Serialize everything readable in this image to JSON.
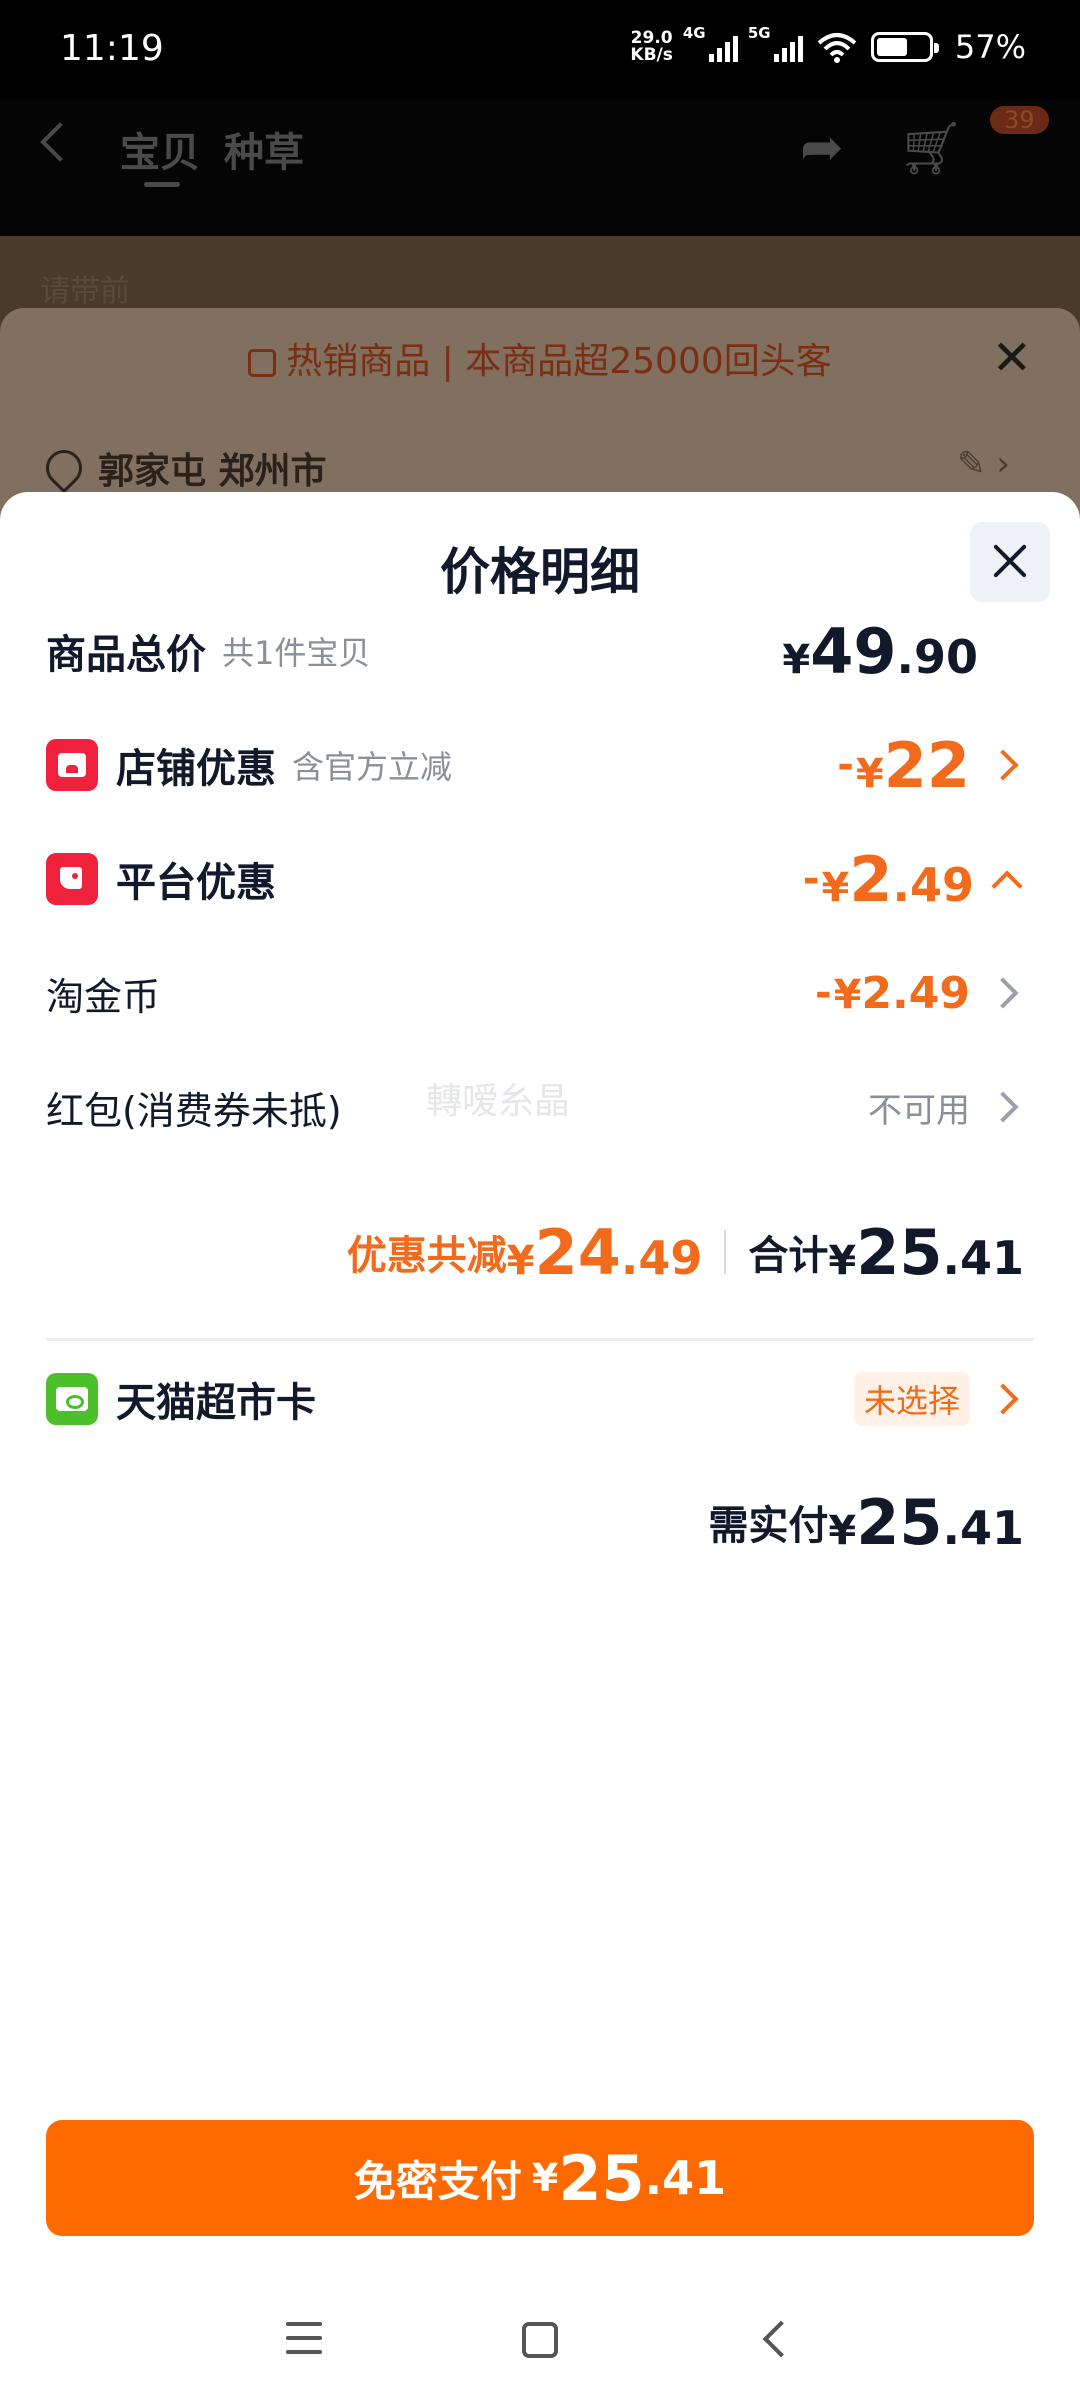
{
  "status_bar": {
    "time": "11:19",
    "net_speed_value": "29.0",
    "net_speed_unit": "KB/s",
    "signal1_label": "4G",
    "signal2_label": "5G",
    "battery": "57%"
  },
  "background": {
    "tabs": [
      "宝贝",
      "种草"
    ],
    "cart_badge": "39",
    "image_caption": "请带前",
    "banner": "热销商品 | 本商品超25000回头客",
    "address": "郭家屯 郑州市"
  },
  "modal": {
    "title": "价格明细",
    "rows": {
      "total": {
        "label": "商品总价",
        "sub": "共1件宝贝",
        "currency": "¥",
        "int": "49",
        "dec": ".90"
      },
      "shop_discount": {
        "label": "店铺优惠",
        "sub": "含官方立减",
        "neg": "-",
        "currency": "¥",
        "int": "22",
        "dec": ""
      },
      "platform_discount": {
        "label": "平台优惠",
        "neg": "-",
        "currency": "¥",
        "int": "2",
        "dec": ".49"
      },
      "coins": {
        "label": "淘金币",
        "neg": "-",
        "currency": "¥",
        "value": "2.49"
      },
      "red_packet": {
        "label": "红包(消费券未抵)",
        "value": "不可用",
        "watermark": "轉嗳糸晶"
      }
    },
    "summary": {
      "discount_label": "优惠共减",
      "discount_currency": "¥",
      "discount_int": "24",
      "discount_dec": ".49",
      "total_label": "合计",
      "total_currency": "¥",
      "total_int": "25",
      "total_dec": ".41"
    },
    "tmall_card": {
      "label": "天猫超市卡",
      "status": "未选择"
    },
    "need_pay": {
      "label": "需实付",
      "currency": "¥",
      "int": "25",
      "dec": ".41"
    },
    "pay_button": {
      "label": "免密支付",
      "currency": "¥",
      "int": "25",
      "dec": ".41"
    }
  },
  "colors": {
    "accent": "#f26a1b",
    "pay_button": "#ff6a00",
    "shop_icon": "#f0213a",
    "card_icon": "#4cc02a"
  }
}
